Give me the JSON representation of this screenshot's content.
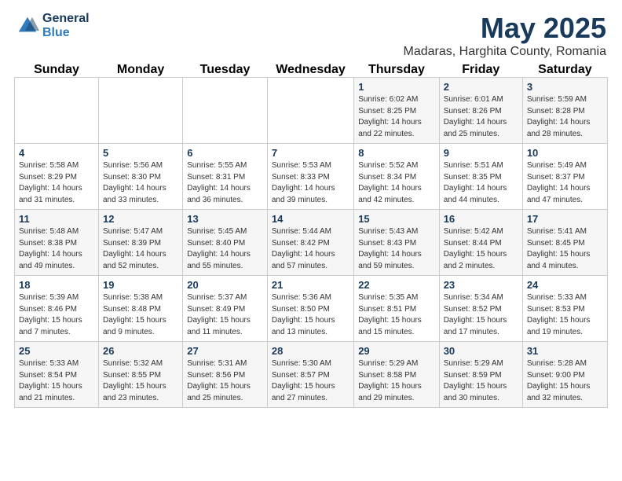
{
  "header": {
    "logo_general": "General",
    "logo_blue": "Blue",
    "main_title": "May 2025",
    "subtitle": "Madaras, Harghita County, Romania"
  },
  "calendar": {
    "days_of_week": [
      "Sunday",
      "Monday",
      "Tuesday",
      "Wednesday",
      "Thursday",
      "Friday",
      "Saturday"
    ],
    "weeks": [
      [
        {
          "day": "",
          "info": ""
        },
        {
          "day": "",
          "info": ""
        },
        {
          "day": "",
          "info": ""
        },
        {
          "day": "",
          "info": ""
        },
        {
          "day": "1",
          "info": "Sunrise: 6:02 AM\nSunset: 8:25 PM\nDaylight: 14 hours\nand 22 minutes."
        },
        {
          "day": "2",
          "info": "Sunrise: 6:01 AM\nSunset: 8:26 PM\nDaylight: 14 hours\nand 25 minutes."
        },
        {
          "day": "3",
          "info": "Sunrise: 5:59 AM\nSunset: 8:28 PM\nDaylight: 14 hours\nand 28 minutes."
        }
      ],
      [
        {
          "day": "4",
          "info": "Sunrise: 5:58 AM\nSunset: 8:29 PM\nDaylight: 14 hours\nand 31 minutes."
        },
        {
          "day": "5",
          "info": "Sunrise: 5:56 AM\nSunset: 8:30 PM\nDaylight: 14 hours\nand 33 minutes."
        },
        {
          "day": "6",
          "info": "Sunrise: 5:55 AM\nSunset: 8:31 PM\nDaylight: 14 hours\nand 36 minutes."
        },
        {
          "day": "7",
          "info": "Sunrise: 5:53 AM\nSunset: 8:33 PM\nDaylight: 14 hours\nand 39 minutes."
        },
        {
          "day": "8",
          "info": "Sunrise: 5:52 AM\nSunset: 8:34 PM\nDaylight: 14 hours\nand 42 minutes."
        },
        {
          "day": "9",
          "info": "Sunrise: 5:51 AM\nSunset: 8:35 PM\nDaylight: 14 hours\nand 44 minutes."
        },
        {
          "day": "10",
          "info": "Sunrise: 5:49 AM\nSunset: 8:37 PM\nDaylight: 14 hours\nand 47 minutes."
        }
      ],
      [
        {
          "day": "11",
          "info": "Sunrise: 5:48 AM\nSunset: 8:38 PM\nDaylight: 14 hours\nand 49 minutes."
        },
        {
          "day": "12",
          "info": "Sunrise: 5:47 AM\nSunset: 8:39 PM\nDaylight: 14 hours\nand 52 minutes."
        },
        {
          "day": "13",
          "info": "Sunrise: 5:45 AM\nSunset: 8:40 PM\nDaylight: 14 hours\nand 55 minutes."
        },
        {
          "day": "14",
          "info": "Sunrise: 5:44 AM\nSunset: 8:42 PM\nDaylight: 14 hours\nand 57 minutes."
        },
        {
          "day": "15",
          "info": "Sunrise: 5:43 AM\nSunset: 8:43 PM\nDaylight: 14 hours\nand 59 minutes."
        },
        {
          "day": "16",
          "info": "Sunrise: 5:42 AM\nSunset: 8:44 PM\nDaylight: 15 hours\nand 2 minutes."
        },
        {
          "day": "17",
          "info": "Sunrise: 5:41 AM\nSunset: 8:45 PM\nDaylight: 15 hours\nand 4 minutes."
        }
      ],
      [
        {
          "day": "18",
          "info": "Sunrise: 5:39 AM\nSunset: 8:46 PM\nDaylight: 15 hours\nand 7 minutes."
        },
        {
          "day": "19",
          "info": "Sunrise: 5:38 AM\nSunset: 8:48 PM\nDaylight: 15 hours\nand 9 minutes."
        },
        {
          "day": "20",
          "info": "Sunrise: 5:37 AM\nSunset: 8:49 PM\nDaylight: 15 hours\nand 11 minutes."
        },
        {
          "day": "21",
          "info": "Sunrise: 5:36 AM\nSunset: 8:50 PM\nDaylight: 15 hours\nand 13 minutes."
        },
        {
          "day": "22",
          "info": "Sunrise: 5:35 AM\nSunset: 8:51 PM\nDaylight: 15 hours\nand 15 minutes."
        },
        {
          "day": "23",
          "info": "Sunrise: 5:34 AM\nSunset: 8:52 PM\nDaylight: 15 hours\nand 17 minutes."
        },
        {
          "day": "24",
          "info": "Sunrise: 5:33 AM\nSunset: 8:53 PM\nDaylight: 15 hours\nand 19 minutes."
        }
      ],
      [
        {
          "day": "25",
          "info": "Sunrise: 5:33 AM\nSunset: 8:54 PM\nDaylight: 15 hours\nand 21 minutes."
        },
        {
          "day": "26",
          "info": "Sunrise: 5:32 AM\nSunset: 8:55 PM\nDaylight: 15 hours\nand 23 minutes."
        },
        {
          "day": "27",
          "info": "Sunrise: 5:31 AM\nSunset: 8:56 PM\nDaylight: 15 hours\nand 25 minutes."
        },
        {
          "day": "28",
          "info": "Sunrise: 5:30 AM\nSunset: 8:57 PM\nDaylight: 15 hours\nand 27 minutes."
        },
        {
          "day": "29",
          "info": "Sunrise: 5:29 AM\nSunset: 8:58 PM\nDaylight: 15 hours\nand 29 minutes."
        },
        {
          "day": "30",
          "info": "Sunrise: 5:29 AM\nSunset: 8:59 PM\nDaylight: 15 hours\nand 30 minutes."
        },
        {
          "day": "31",
          "info": "Sunrise: 5:28 AM\nSunset: 9:00 PM\nDaylight: 15 hours\nand 32 minutes."
        }
      ]
    ]
  }
}
